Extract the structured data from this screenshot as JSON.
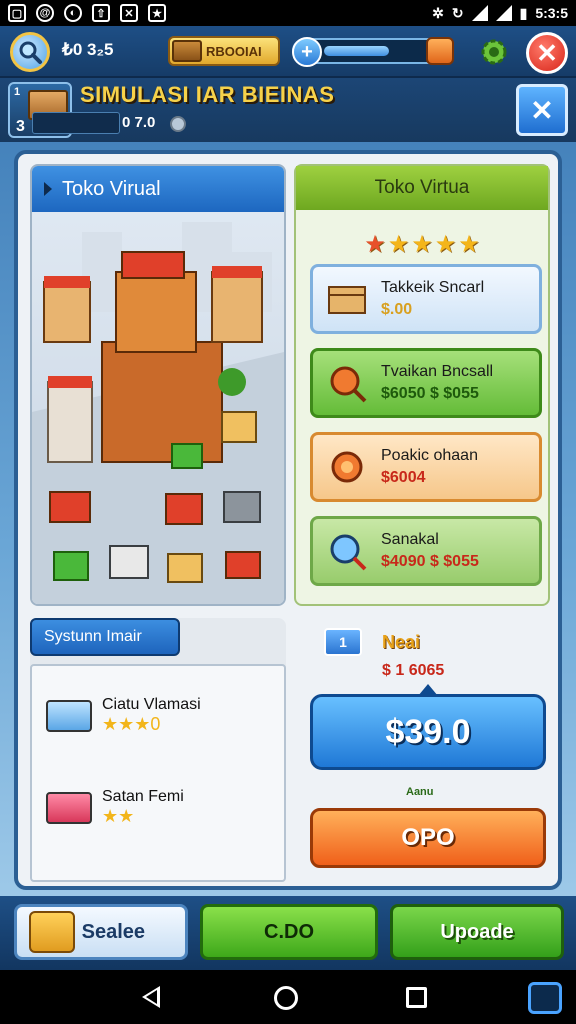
{
  "status_bar": {
    "time": "5:3:5",
    "icons": [
      "gallery-icon",
      "at-icon",
      "drop-icon",
      "upload-icon",
      "image-icon",
      "star-icon"
    ]
  },
  "hud": {
    "coins": "₺0 3₂5",
    "gold_label": "RBOOIAI",
    "progress_fraction": 0.68
  },
  "header": {
    "level_top": "1",
    "level_num": "3",
    "title": "SIMULASI IAR BIEINAS",
    "xp_value": "0 7.0"
  },
  "shop": {
    "title": "Toko Virual"
  },
  "virtual": {
    "title": "Toko Virtua",
    "stars": 5,
    "offers": [
      {
        "name": "Takkeik Sncarl",
        "price": "$.00"
      },
      {
        "name": "Tvaikan Bncsall",
        "price": "$6050 $ $055"
      },
      {
        "name": "Poakic ohaan",
        "price": "$6004"
      },
      {
        "name": "Sanakal",
        "price": "$4090 $ $055"
      }
    ]
  },
  "system": {
    "title": "Systunn Imair",
    "items": [
      {
        "name": "Ciatu Vlamasi",
        "stars": "★★★0"
      },
      {
        "name": "Satan Femi",
        "stars": "★★"
      }
    ]
  },
  "news": {
    "badge": "1",
    "title": "Neai",
    "price": "$ 1 6065",
    "big_value": "$39.0",
    "small_label": "Aanu",
    "orange_label": "OPO"
  },
  "bottom": {
    "search_label": "Sealee",
    "cdo_label": "C.DO",
    "upgrade_label": "Upoade"
  },
  "colors": {
    "accent_blue": "#1f78d6",
    "accent_green": "#3ea81a",
    "accent_orange": "#f0601a",
    "title_gold": "#f7d24a"
  }
}
